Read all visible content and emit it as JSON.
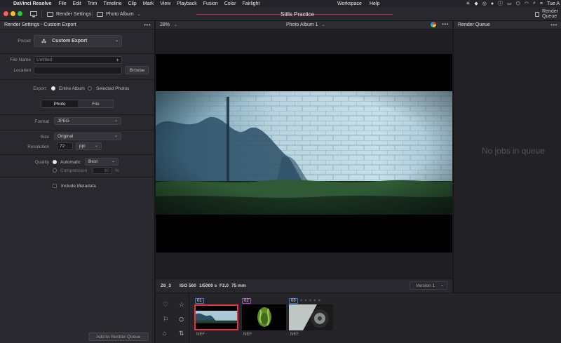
{
  "menubar": {
    "app": "DaVinci Resolve",
    "items": [
      "File",
      "Edit",
      "Trim",
      "Timeline",
      "Clip",
      "Mark",
      "View",
      "Playback",
      "Fusion",
      "Color",
      "Fairlight"
    ],
    "workspace": "Workspace",
    "help": "Help",
    "clock": "Tue A"
  },
  "toolbar": {
    "render_settings": "Render Settings",
    "photo_album": "Photo Album",
    "project_title": "Stills Practice",
    "render_queue_btn": "Render Queue",
    "colors": {
      "close": "#fe5f57",
      "min": "#febc2e",
      "max": "#28c840"
    }
  },
  "left": {
    "title": "Render Settings - Custom Export",
    "preset_label": "Preset",
    "preset_value": "Custom Export",
    "file_name_label": "File Name",
    "file_name_value": "Untitled",
    "location_label": "Location",
    "location_value": "",
    "browse": "Browse",
    "export_label": "Export",
    "export_entire": "Entire Album",
    "export_selected": "Selected Photos",
    "tab_photo": "Photo",
    "tab_file": "File",
    "format_label": "Format",
    "format_value": "JPEG",
    "size_label": "Size",
    "size_value": "Original",
    "resolution_label": "Resolution",
    "resolution_value": "72",
    "resolution_unit": "ppi",
    "quality_label": "Quality",
    "quality_auto": "Automatic",
    "quality_auto_value": "Best",
    "quality_compression": "Compression",
    "compression_value": "80",
    "compression_unit": "%",
    "include_metadata": "Include Metadata",
    "add_to_queue": "Add to Render Queue"
  },
  "viewer": {
    "zoom": "28%",
    "album": "Photo Album 1",
    "clip_name": "Z6_3",
    "iso": "ISO 560",
    "shutter": "1/5000 s",
    "aperture": "F2.0",
    "focal": "75 mm",
    "version": "Version 1"
  },
  "thumbnails": [
    {
      "num": "01",
      "label": "NEF",
      "color": "#3a7bd5",
      "selected": true
    },
    {
      "num": "02",
      "label": "NEF",
      "color": "#b544c8",
      "selected": false
    },
    {
      "num": "03",
      "label": "NEF",
      "color": "#3a7bd5",
      "selected": false
    }
  ],
  "render_queue": {
    "title": "Render Queue",
    "empty_text": "No jobs in queue"
  }
}
